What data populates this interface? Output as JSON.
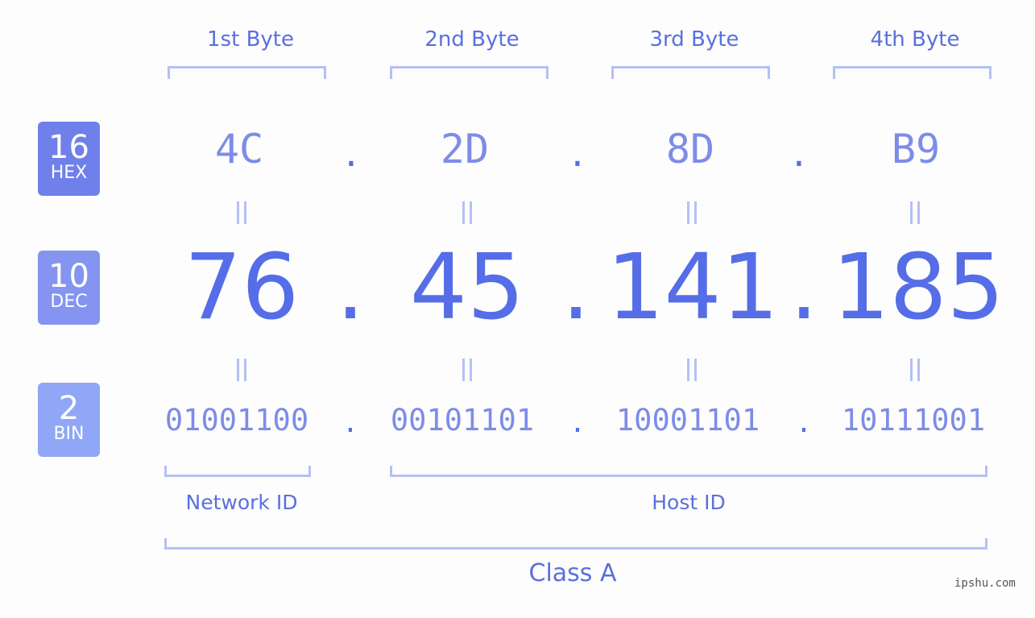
{
  "badges": [
    {
      "number": "16",
      "label": "HEX",
      "color": "#7080ea"
    },
    {
      "number": "10",
      "label": "DEC",
      "color": "#8494f0"
    },
    {
      "number": "2",
      "label": "BIN",
      "color": "#90a6f6"
    }
  ],
  "bytes": [
    {
      "label": "1st Byte",
      "hex": "4C",
      "dec": "76",
      "bin": "01001100"
    },
    {
      "label": "2nd Byte",
      "hex": "2D",
      "dec": "45",
      "bin": "00101101"
    },
    {
      "label": "3rd Byte",
      "hex": "8D",
      "dec": "141",
      "bin": "10001101"
    },
    {
      "label": "4th Byte",
      "hex": "B9",
      "dec": "185",
      "bin": "10111001"
    }
  ],
  "separator": ".",
  "network_label": "Network ID",
  "host_label": "Host ID",
  "class_label": "Class A",
  "watermark": "ipshu.com",
  "colors": {
    "accent": "#566de8",
    "light": "#b4c0f5",
    "mid": "#7d8ce8"
  }
}
